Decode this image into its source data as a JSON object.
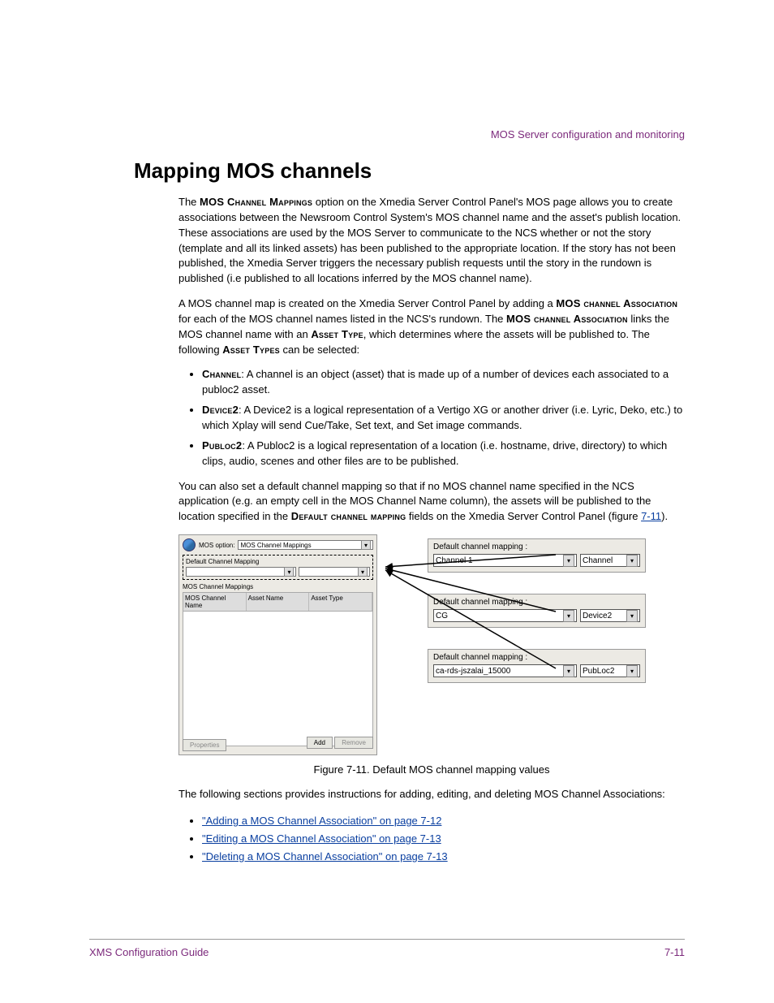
{
  "header": {
    "section_title": "MOS Server configuration and monitoring"
  },
  "title": "Mapping MOS channels",
  "para1_a": "The ",
  "para1_sc1": "MOS Channel Mappings",
  "para1_b": " option on the Xmedia Server Control Panel's MOS page allows you to create associations between the Newsroom Control System's MOS channel name and the asset's publish location. These associations are used by the MOS Server to communicate to the NCS whether or not the story (template and all its linked assets) has been published to the appropriate location. If the story has not been published, the Xmedia Server triggers the necessary publish requests until the story in the rundown is published (i.e published to all locations inferred by the MOS channel name).",
  "para2_a": "A MOS channel map is created on the Xmedia Server Control Panel by adding a ",
  "para2_sc1": "MOS channel Association",
  "para2_b": " for each of the MOS channel names listed in the NCS's rundown. The ",
  "para2_sc2": "MOS channel Association",
  "para2_c": " links the MOS channel name with an ",
  "para2_sc3": "Asset Type",
  "para2_d": ", which determines where the assets will be published to. The following ",
  "para2_sc4": "Asset Types",
  "para2_e": " can be selected:",
  "bullets1": {
    "b1_sc": "Channel",
    "b1_text": ": A channel is an object (asset) that is made up of a number of devices each associated to a publoc2 asset.",
    "b2_sc": "Device2",
    "b2_text": ": A Device2 is a logical representation of a Vertigo XG or another driver (i.e. Lyric, Deko, etc.) to which Xplay will send Cue/Take, Set text, and Set image commands.",
    "b3_sc": "Publoc2",
    "b3_text": ": A Publoc2 is a logical representation of a location (i.e. hostname, drive, directory) to which clips, audio, scenes and other files are to be published."
  },
  "para3_a": "You can also set a default channel mapping so that if no MOS channel name specified in the NCS application (e.g. an empty cell in the MOS Channel Name column), the assets will be published to the location specified in the ",
  "para3_sc1": "Default channel mapping",
  "para3_b": " fields on the Xmedia Server Control Panel (figure ",
  "para3_xref": "7-11",
  "para3_c": ").",
  "panel": {
    "mos_option_label": "MOS option:",
    "mos_option_value": "MOS Channel Mappings",
    "default_label": "Default Channel Mapping",
    "table_headers": [
      "MOS Channel Name",
      "Asset Name",
      "Asset Type"
    ],
    "buttons": {
      "properties": "Properties",
      "add": "Add",
      "remove": "Remove"
    }
  },
  "details": [
    {
      "label": "Default channel mapping :",
      "value": "Channel 1",
      "type": "Channel"
    },
    {
      "label": "Default channel mapping :",
      "value": "CG",
      "type": "Device2"
    },
    {
      "label": "Default channel mapping :",
      "value": "ca-rds-jszalai_15000",
      "type": "PubLoc2"
    }
  ],
  "figure_caption": "Figure 7-11. Default MOS channel mapping values",
  "para4": "The following sections provides instructions for adding, editing, and deleting MOS Channel Associations:",
  "links": [
    "\"Adding a MOS Channel Association\" on page 7-12",
    "\"Editing a MOS Channel Association\" on page 7-13",
    "\"Deleting a MOS Channel Association\" on page 7-13"
  ],
  "footer": {
    "left": "XMS Configuration Guide",
    "right": "7-11"
  }
}
